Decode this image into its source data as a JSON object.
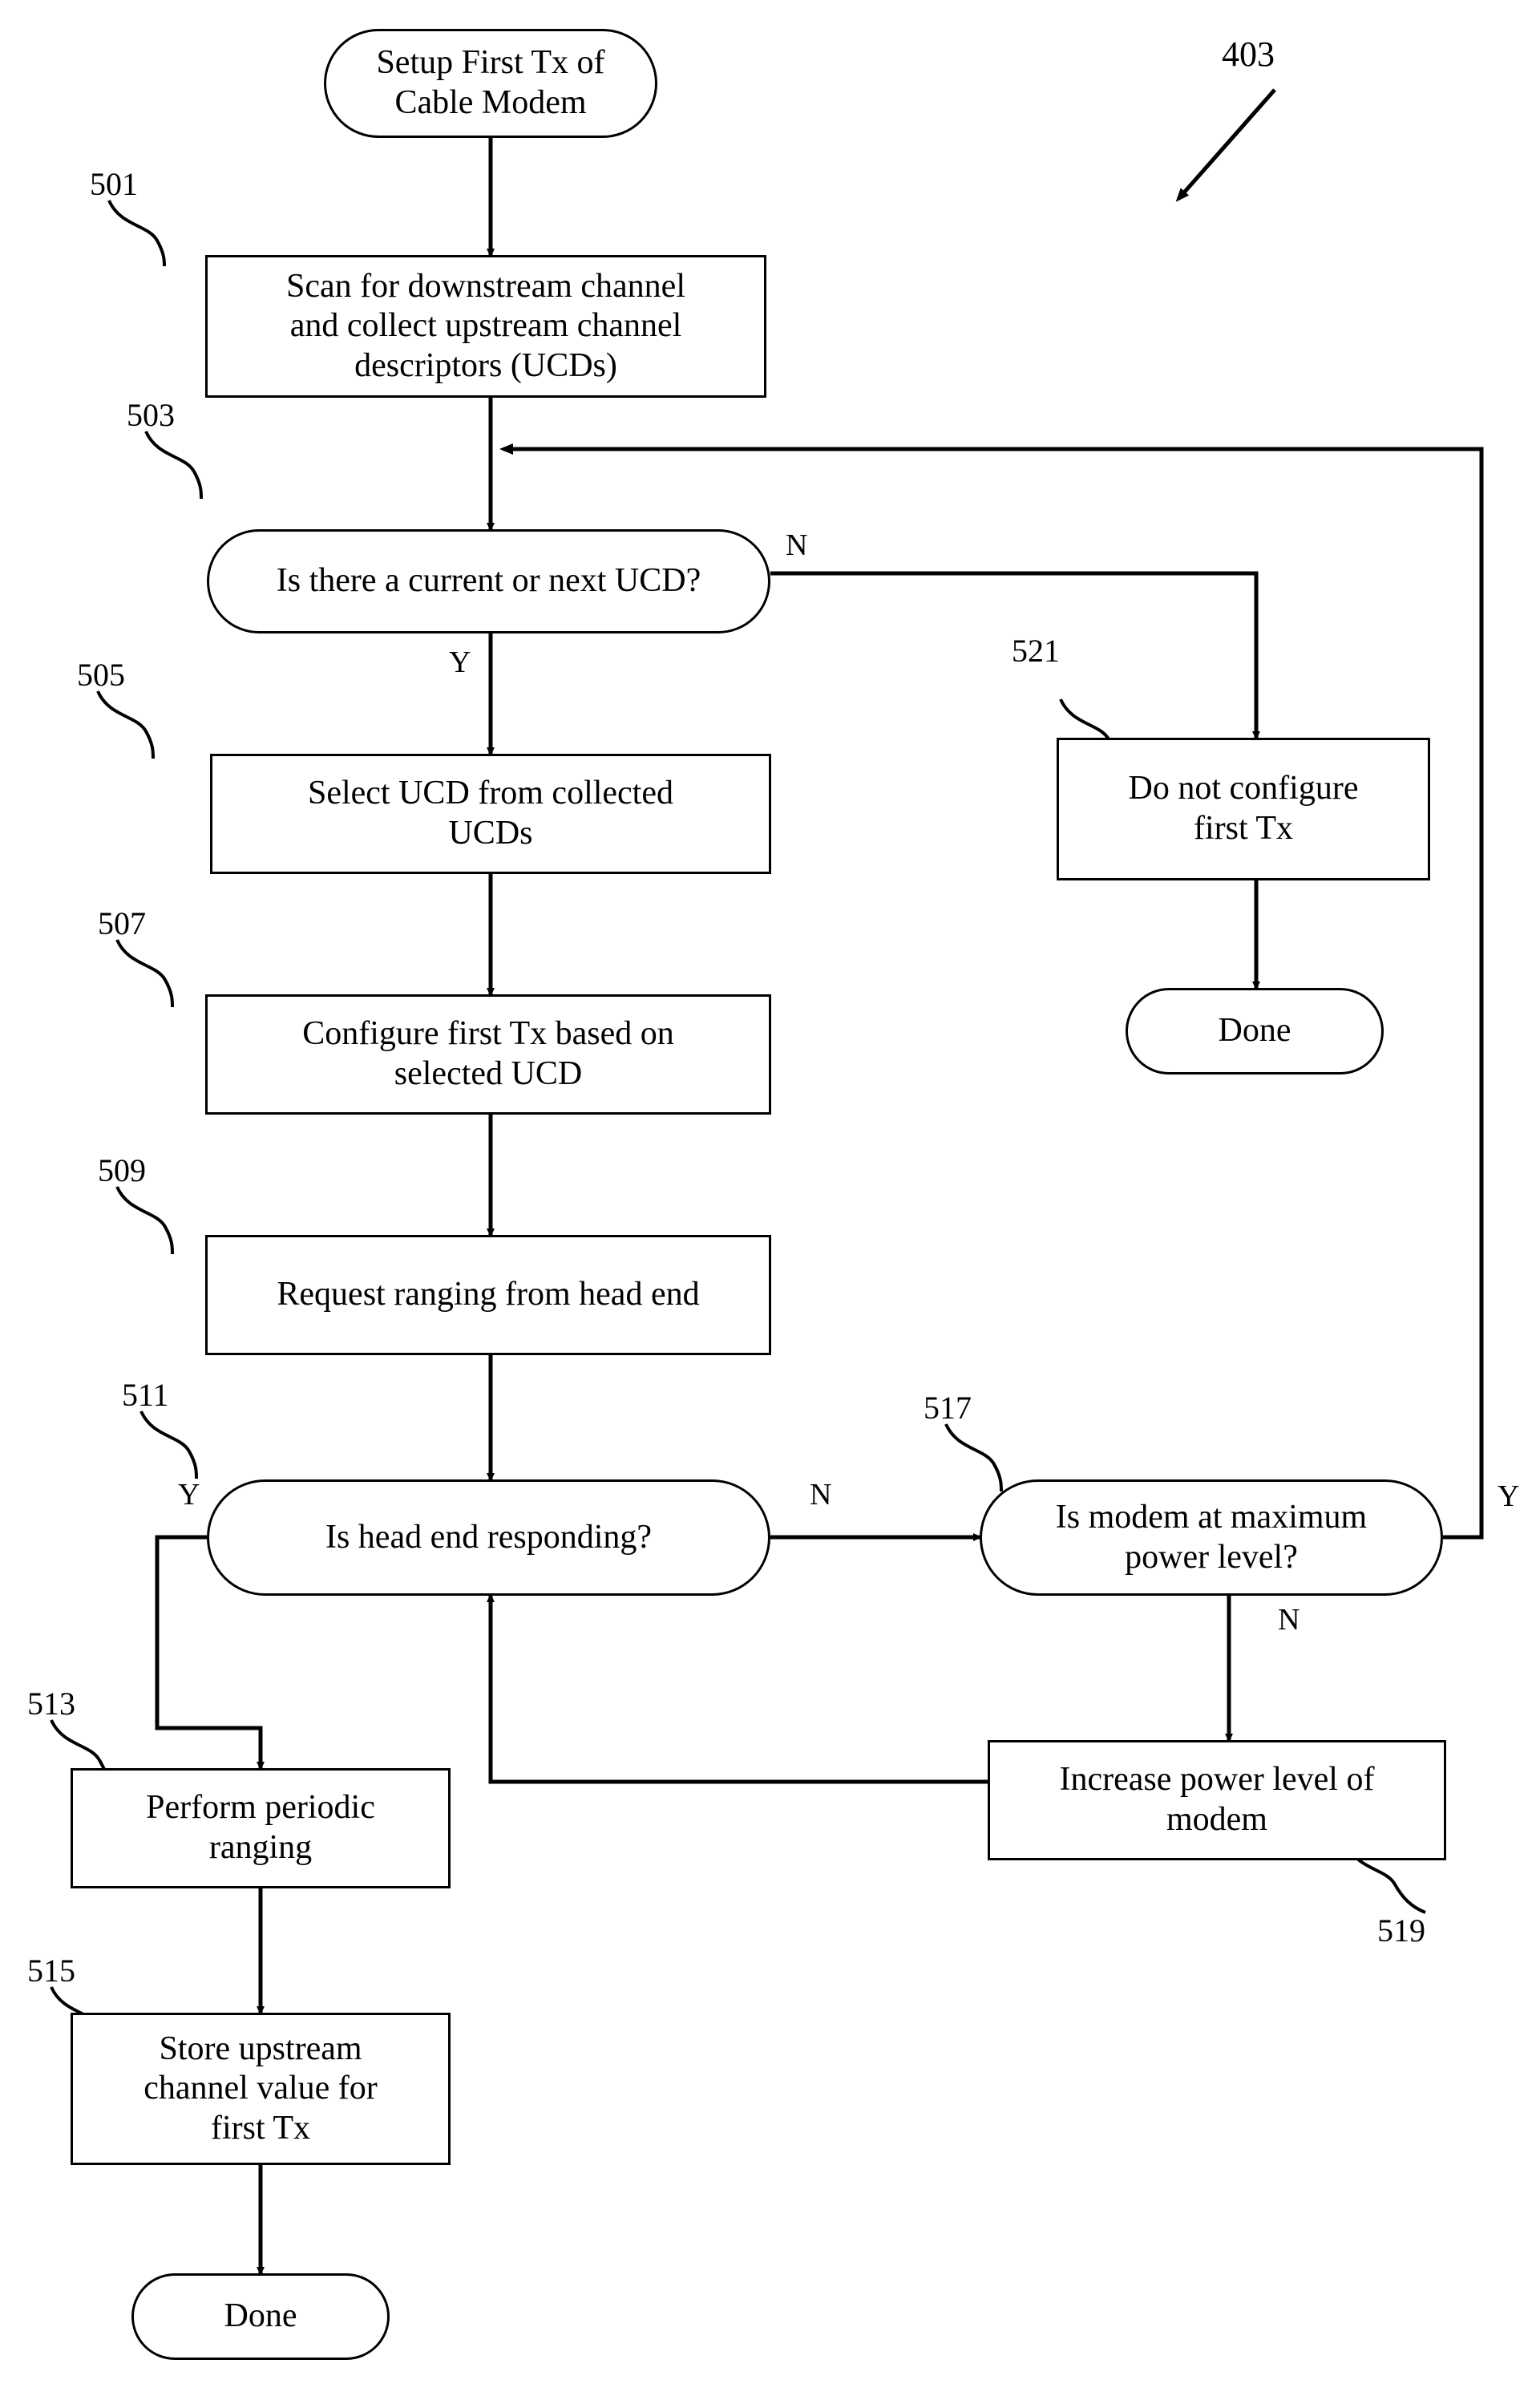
{
  "figure": {
    "reference_numeral": "403"
  },
  "nodes": [
    {
      "id": "start",
      "name": "start-terminator",
      "text": "Setup First Tx of\nCable Modem",
      "ref": ""
    },
    {
      "id": "n501",
      "name": "process-scan-downstream",
      "text": "Scan for downstream channel\nand collect upstream channel\ndescriptors (UCDs)",
      "ref": "501"
    },
    {
      "id": "n503",
      "name": "decision-current-ucd",
      "text": "Is there a current or next UCD?",
      "ref": "503"
    },
    {
      "id": "n505",
      "name": "process-select-ucd",
      "text": "Select UCD from collected\nUCDs",
      "ref": "505"
    },
    {
      "id": "n507",
      "name": "process-configure-tx",
      "text": "Configure first Tx based on\nselected UCD",
      "ref": "507"
    },
    {
      "id": "n509",
      "name": "process-request-ranging",
      "text": "Request ranging from head end",
      "ref": "509"
    },
    {
      "id": "n511",
      "name": "decision-head-end",
      "text": "Is head end responding?",
      "ref": "511"
    },
    {
      "id": "n513",
      "name": "process-periodic-ranging",
      "text": "Perform periodic\nranging",
      "ref": "513"
    },
    {
      "id": "n515",
      "name": "process-store-value",
      "text": "Store upstream\nchannel value for\nfirst Tx",
      "ref": "515"
    },
    {
      "id": "n517",
      "name": "decision-max-power",
      "text": "Is modem at maximum\npower level?",
      "ref": "517"
    },
    {
      "id": "n519",
      "name": "process-increase-power",
      "text": "Increase power level of\nmodem",
      "ref": "519"
    },
    {
      "id": "n521",
      "name": "process-do-not-configure",
      "text": "Do not configure\nfirst Tx",
      "ref": "521"
    },
    {
      "id": "done1",
      "name": "done-terminator-right",
      "text": "Done",
      "ref": ""
    },
    {
      "id": "done2",
      "name": "done-terminator-left",
      "text": "Done",
      "ref": ""
    }
  ],
  "branch_labels": {
    "d503_no": "N",
    "d503_yes": "Y",
    "d511_no": "N",
    "d511_yes": "Y",
    "d517_no": "N",
    "d517_yes": "Y"
  }
}
